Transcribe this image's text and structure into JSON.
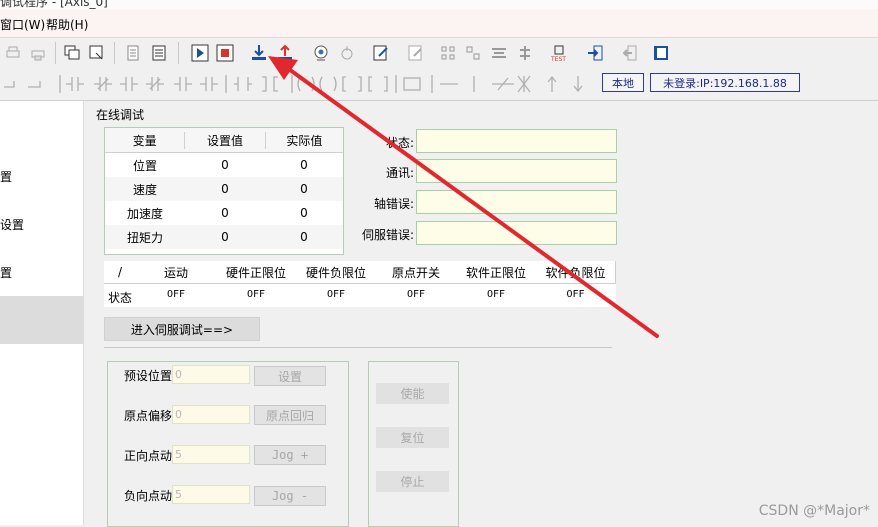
{
  "window": {
    "title": "调试程序 - [Axis_0]"
  },
  "menu": {
    "items": [
      "窗口(W)",
      "帮助(H)"
    ]
  },
  "toolbar": {
    "local_label": "本地",
    "login_status": "未登录:IP:192.168.1.88",
    "icons": [
      "print-icon",
      "print-setup-icon",
      "cascade-icon",
      "tile-icon",
      "document-icon",
      "calculator-icon",
      "run-icon",
      "stop-icon",
      "download-icon",
      "upload-icon",
      "camera-icon",
      "scope-icon",
      "edit-icon",
      "notes-icon",
      "grid-icon",
      "grid2-icon",
      "align-icon",
      "distribute-icon",
      "test-icon",
      "login-icon",
      "logout-icon",
      "book-icon"
    ]
  },
  "sidebar": {
    "items": [
      "置",
      "设置",
      "置"
    ]
  },
  "online_debug": {
    "title": "在线调试",
    "table": {
      "headers": [
        "变量",
        "设置值",
        "实际值"
      ],
      "rows": [
        {
          "name": "位置",
          "set": "0",
          "actual": "0"
        },
        {
          "name": "速度",
          "set": "0",
          "actual": "0"
        },
        {
          "name": "加速度",
          "set": "0",
          "actual": "0"
        },
        {
          "name": "扭矩力",
          "set": "0",
          "actual": "0"
        }
      ]
    },
    "status_fields": [
      {
        "label": "状态:",
        "value": ""
      },
      {
        "label": "通讯:",
        "value": ""
      },
      {
        "label": "轴错误:",
        "value": ""
      },
      {
        "label": "伺服错误:",
        "value": ""
      }
    ]
  },
  "flags": {
    "headers": [
      "/",
      "运动",
      "硬件正限位",
      "硬件负限位",
      "原点开关",
      "软件正限位",
      "软件负限位"
    ],
    "row_label": "状态",
    "values": [
      "OFF",
      "OFF",
      "OFF",
      "OFF",
      "OFF",
      "OFF"
    ]
  },
  "servo_debug_button": "进入伺服调试==>",
  "params": [
    {
      "label": "预设位置",
      "value": "0",
      "button": "设置"
    },
    {
      "label": "原点偏移",
      "value": "0",
      "button": "原点回归"
    },
    {
      "label": "正向点动",
      "value": "5",
      "button": "Jog +"
    },
    {
      "label": "负向点动",
      "value": "5",
      "button": "Jog -"
    }
  ],
  "actions": [
    "使能",
    "复位",
    "停止"
  ],
  "watermark": "CSDN @*Major*",
  "colors": {
    "arrow": "#e0282e",
    "field_bg": "#fefde8",
    "field_border": "#a9cfa9",
    "link_blue": "#1c2a8c"
  }
}
